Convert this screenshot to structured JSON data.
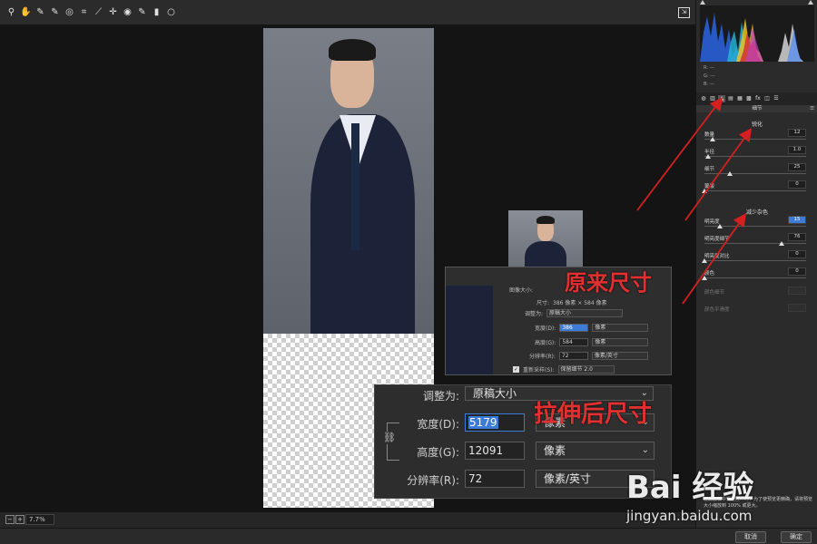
{
  "toolbar": {
    "tools": [
      "zoom-icon",
      "hand-icon",
      "white-balance-icon",
      "color-sampler-icon",
      "target-adjust-icon",
      "crop-icon",
      "straighten-icon",
      "spot-removal-icon",
      "red-eye-icon",
      "brush-icon",
      "graduated-filter-icon",
      "radial-filter-icon"
    ],
    "tool_glyphs": [
      "⚲",
      "✋",
      "✎",
      "✎",
      "◎",
      "⌗",
      "⟋",
      "✛",
      "◉",
      "✎",
      "▮",
      "○"
    ]
  },
  "histogram": {
    "r_label": "R:",
    "g_label": "G:",
    "b_label": "B:",
    "r": "---",
    "g": "---",
    "b": "---"
  },
  "panel": {
    "tab_glyphs": [
      "◍",
      "▥",
      "▲",
      "▤",
      "▦",
      "▩",
      "fx",
      "◫",
      "☰"
    ],
    "header": "细节",
    "sharpen_title": "锐化",
    "sharpen": [
      {
        "label": "数量",
        "value": "12",
        "fraction": 0.08
      },
      {
        "label": "半径",
        "value": "1.0",
        "fraction": 0.04
      },
      {
        "label": "细节",
        "value": "25",
        "fraction": 0.25
      },
      {
        "label": "蒙版",
        "value": "0",
        "fraction": 0.0
      }
    ],
    "noise_title": "减少杂色",
    "noise": [
      {
        "label": "明亮度",
        "value": "15",
        "fraction": 0.15,
        "selected": true
      },
      {
        "label": "明亮度细节",
        "value": "76",
        "fraction": 0.76
      },
      {
        "label": "明亮度对比",
        "value": "0",
        "fraction": 0.0
      },
      {
        "label": "颜色",
        "value": "0",
        "fraction": 0.0
      }
    ],
    "disabled": [
      {
        "label": "颜色细节"
      },
      {
        "label": "颜色平滑度"
      }
    ],
    "notice": "在此面板中调整控件时，为了使预览更精确，请将预览大小缩放到 100% 或更大。"
  },
  "original_dialog": {
    "image_size_label": "图像大小:",
    "dimensions_label": "尺寸:",
    "dimensions_value": "386 像素 × 584 像素",
    "fit_label": "调整为:",
    "fit_value": "原稿大小",
    "width_label": "宽度(D):",
    "width_value": "386",
    "height_label": "高度(G):",
    "height_value": "584",
    "res_label": "分辨率(R):",
    "res_value": "72",
    "unit_px": "像素",
    "unit_ppi": "像素/英寸",
    "resample_label": "重新采样(S):",
    "resample_value": "保留细节 2.0"
  },
  "stretched_dialog": {
    "fit_label": "调整为:",
    "fit_value": "原稿大小",
    "width_label": "宽度(D):",
    "width_value": "5179",
    "height_label": "高度(G):",
    "height_value": "12091",
    "res_label": "分辨率(R):",
    "res_value": "72",
    "unit_px": "像素",
    "unit_ppi": "像素/英寸"
  },
  "annotations": {
    "original": "原来尺寸",
    "stretched": "拉伸后尺寸"
  },
  "bottom": {
    "zoom": "7.7%"
  },
  "footer": {
    "cancel": "取消",
    "ok": "确定"
  },
  "watermark": {
    "logo": "Bai 经验",
    "url": "jingyan.baidu.com"
  },
  "colors": {
    "arrow": "#d42020",
    "accent": "#3d7bd8",
    "label": "#e03030"
  }
}
